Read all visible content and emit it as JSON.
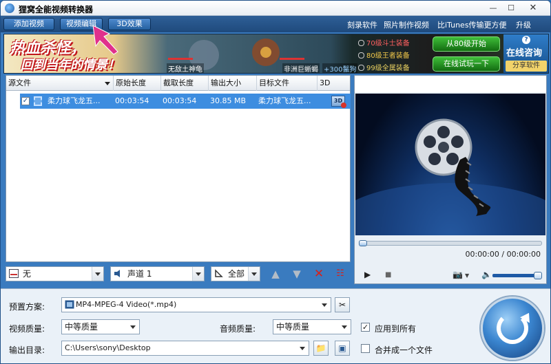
{
  "window": {
    "title": "狸窝全能视频转换器"
  },
  "toolbar": {
    "buttons": [
      "添加视频",
      "视频编辑",
      "3D效果"
    ],
    "links": [
      "刻录软件",
      "照片制作视频",
      "比iTunes传输更方便",
      "升级"
    ]
  },
  "banner": {
    "slogan_line1": "热血杀怪，",
    "slogan_line2": "回到当年的情景！",
    "character_names": [
      "无敌土神龟",
      "非洲巨蜥蝎",
      "+300鬣狗"
    ],
    "options": [
      "70级斗士装备",
      "80级王者装备",
      "99级全属装备"
    ],
    "buttons": [
      "从80级开始",
      "在线试玩一下"
    ],
    "consult_title": "在线咨询",
    "share_label": "分享软件",
    "help_glyph": "?"
  },
  "file_list": {
    "columns": [
      "源文件",
      "原始长度",
      "截取长度",
      "输出大小",
      "目标文件",
      "3D"
    ],
    "rows": [
      {
        "checked": "✓",
        "source": "柔力球飞龙五...",
        "original_length": "00:03:54",
        "clip_length": "00:03:54",
        "output_size": "30.85 MB",
        "target": "柔力球飞龙五...",
        "badge_3d": "3D"
      }
    ]
  },
  "list_controls": {
    "subtitle": "无",
    "audio_track": "声道 1",
    "scope": "全部"
  },
  "preview": {
    "time": "00:00:00 / 00:00:00"
  },
  "settings": {
    "preset_label": "预置方案:",
    "preset_value": "MP4-MPEG-4 Video(*.mp4)",
    "video_quality_label": "视频质量:",
    "video_quality_value": "中等质量",
    "audio_quality_label": "音频质量:",
    "audio_quality_value": "中等质量",
    "apply_all_label": "应用到所有",
    "apply_all_checked": "✓",
    "output_dir_label": "输出目录:",
    "output_dir_value": "C:\\Users\\sony\\Desktop",
    "merge_label": "合并成一个文件"
  },
  "colors": {
    "accent": "#3d8de0",
    "toolbar": "#1f4a7c",
    "pointer": "#e0308c"
  }
}
